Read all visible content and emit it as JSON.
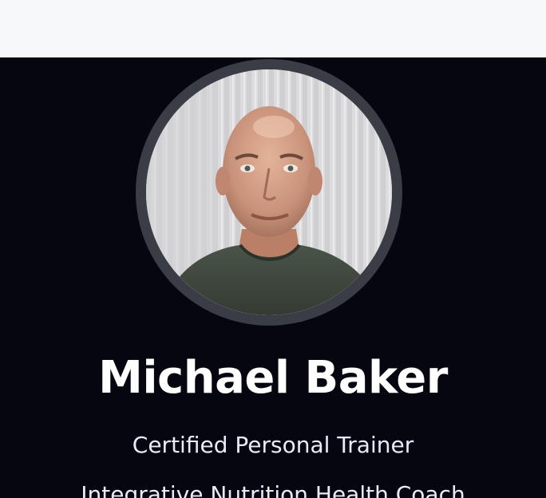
{
  "profile": {
    "name": "Michael Baker",
    "credentials": [
      "Certified Personal Trainer",
      "Integrative Nutrition Health Coach"
    ]
  },
  "colors": {
    "header_bg": "#f7f8fa",
    "hero_bg": "#05060f",
    "avatar_ring": "#3a3c46",
    "text": "#ffffff"
  }
}
